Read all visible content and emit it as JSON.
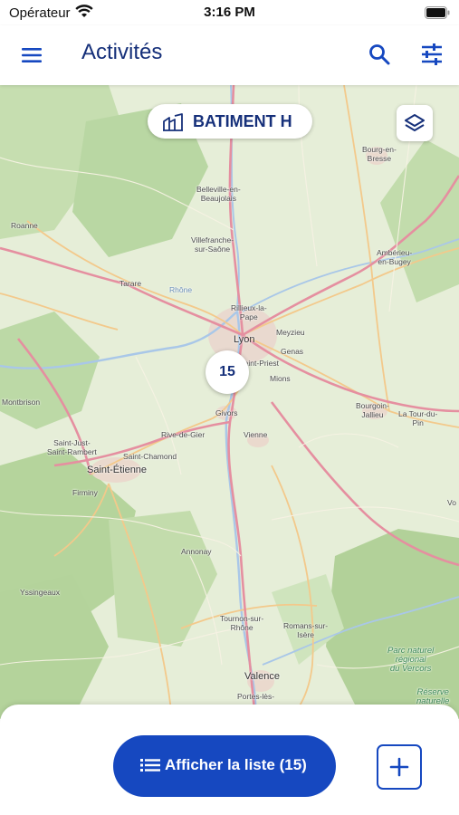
{
  "status_bar": {
    "carrier": "Opérateur",
    "time": "3:16 PM"
  },
  "app_bar": {
    "title": "Activités",
    "icons": [
      "menu-icon",
      "search-icon",
      "filter-icon"
    ]
  },
  "building_selector": {
    "label": "BATIMENT H",
    "icon": "building-icon"
  },
  "map": {
    "layers_icon": "layers-icon",
    "cluster_count": "15",
    "labels": {
      "bourg": "Bourg-en-\nBresse",
      "belleville": "Belleville-en-\nBeaujolais",
      "roanne": "Roanne",
      "villefranche": "Villefranche-\nsur-Saône",
      "amberieu": "Ambérieu-\nen-Bugey",
      "tarare": "Tarare",
      "rhone": "Rhône",
      "rillieux": "Rillieux-la-\nPape",
      "lyon": "Lyon",
      "meyzieu": "Meyzieu",
      "genas": "Genas",
      "saint_priest": "Saint-Priest",
      "mions": "Mions",
      "montbrison": "Montbrison",
      "bourgoin": "Bourgoin-\nJallieu",
      "la_tour": "La Tour-du-\nPin",
      "givors": "Givors",
      "rive_de_gier": "Rive-de-Gier",
      "vienne": "Vienne",
      "saint_just": "Saint-Just-\nSaint-Rambert",
      "saint_chamond": "Saint-Chamond",
      "saint_etienne": "Saint-Étienne",
      "firminy": "Firminy",
      "voiron": "Vo",
      "annonay": "Annonay",
      "yssingeaux": "Yssingeaux",
      "tournon": "Tournon-sur-\nRhône",
      "romans": "Romans-sur-\nIsère",
      "vercors": "Parc naturel\nrégional\ndu Vercors",
      "valence": "Valence",
      "portes": "Portes-lès-",
      "reserve": "Réserve\nnaturelle"
    }
  },
  "bottom_sheet": {
    "list_button_label": "Afficher la liste (15)",
    "add_icon": "plus-icon"
  },
  "colors": {
    "primary": "#1648c0",
    "title": "#16307a",
    "map_land": "#e6eed8",
    "forest": "#b9d7a3",
    "motorway": "#e58fa0",
    "primary_road": "#f3c98b"
  }
}
